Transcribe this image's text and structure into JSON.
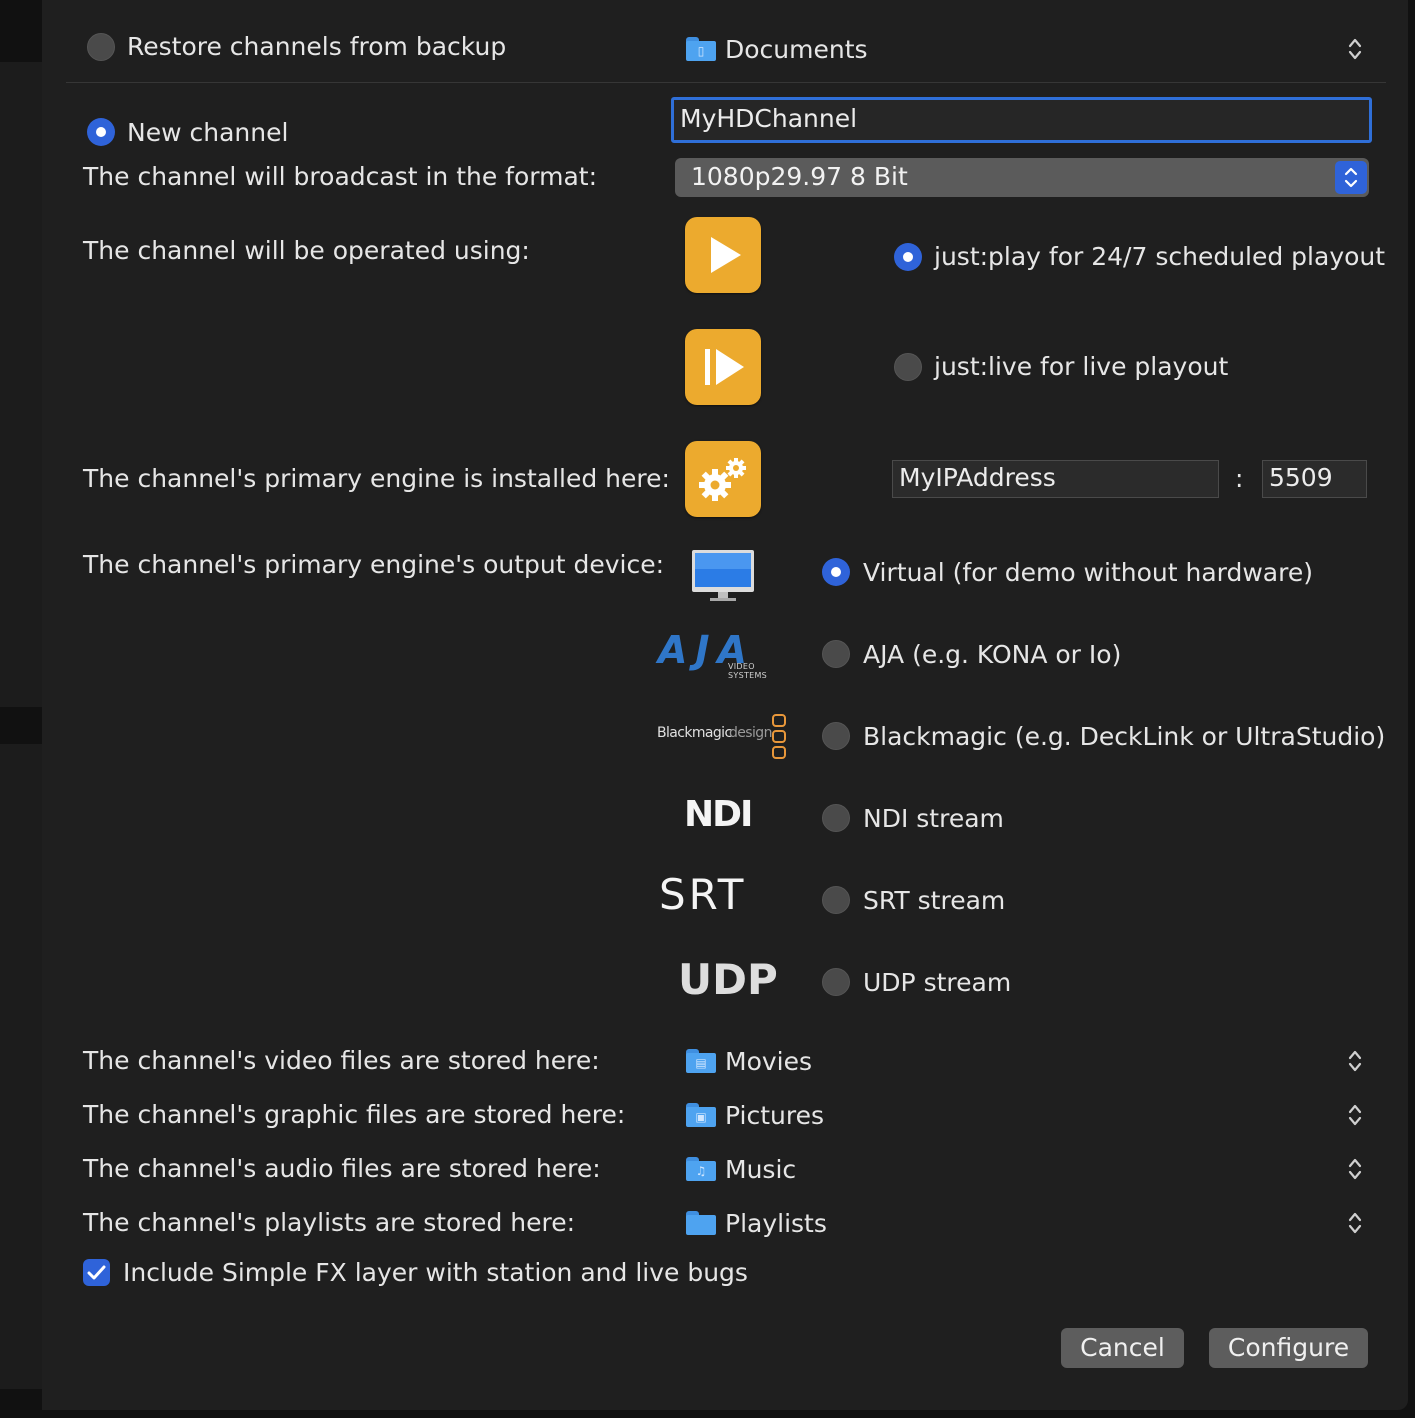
{
  "restore": {
    "label": "Restore channels from backup",
    "selected": false,
    "folder": "Documents"
  },
  "new_channel": {
    "label": "New channel",
    "selected": true,
    "name_value": "MyHDChannel"
  },
  "format": {
    "label": "The channel will broadcast in the format:",
    "value": "1080p29.97 8 Bit"
  },
  "operation": {
    "label": "The channel will be operated using:",
    "options": [
      {
        "label": "just:play for 24/7 scheduled playout",
        "selected": true,
        "icon": "play-icon"
      },
      {
        "label": "just:live for live playout",
        "selected": false,
        "icon": "live-play-icon"
      }
    ]
  },
  "engine": {
    "label": "The channel's primary engine is installed here:",
    "address": "MyIPAddress",
    "separator": ":",
    "port": "5509",
    "icon": "gears-icon"
  },
  "output": {
    "label": "The channel's primary engine's output device:",
    "aja_logo": "AJA",
    "aja_sub": "VIDEO SYSTEMS",
    "bm_logo_a": "Blackmagic",
    "bm_logo_b": "design",
    "ndi_logo": "NDI",
    "srt_logo": "SRT",
    "udp_logo": "UDP",
    "options": [
      {
        "label": "Virtual (for demo without hardware)",
        "selected": true
      },
      {
        "label": "AJA (e.g. KONA or Io)",
        "selected": false
      },
      {
        "label": "Blackmagic (e.g. DeckLink or UltraStudio)",
        "selected": false
      },
      {
        "label": "NDI stream",
        "selected": false
      },
      {
        "label": "SRT stream",
        "selected": false
      },
      {
        "label": "UDP stream",
        "selected": false
      }
    ]
  },
  "storage": [
    {
      "label": "The channel's video files are stored here:",
      "folder": "Movies",
      "glyph": "▤"
    },
    {
      "label": "The channel's graphic files are stored here:",
      "folder": "Pictures",
      "glyph": "▣"
    },
    {
      "label": "The channel's audio files are stored here:",
      "folder": "Music",
      "glyph": "♫"
    },
    {
      "label": "The channel's playlists are stored here:",
      "folder": "Playlists",
      "glyph": ""
    }
  ],
  "simple_fx": {
    "label": "Include Simple FX layer with station and live bugs",
    "checked": true
  },
  "buttons": {
    "cancel": "Cancel",
    "configure": "Configure"
  },
  "colors": {
    "accent": "#2f63d9",
    "app_icon": "#ecaa2e",
    "folder": "#4ea3f0",
    "panel": "#1f1f1f"
  }
}
